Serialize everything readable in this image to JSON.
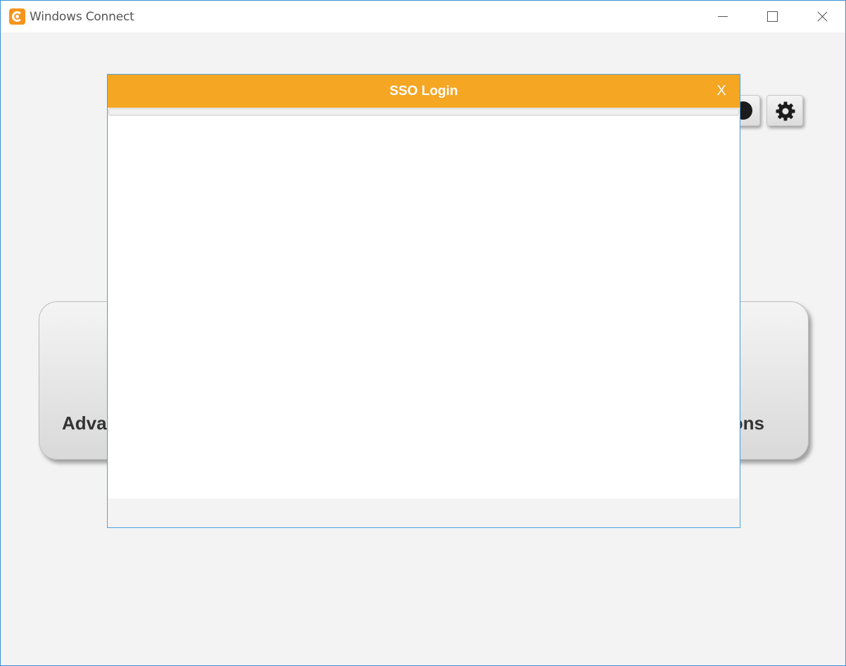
{
  "window": {
    "title": "Windows Connect"
  },
  "main": {
    "tiles": [
      {
        "label": "Adva"
      },
      {
        "label": "ons"
      }
    ],
    "icons": [
      "help-icon",
      "gear-icon"
    ]
  },
  "dialog": {
    "title": "SSO Login",
    "close_label": "X",
    "header_color": "#f5a623"
  },
  "colors": {
    "accent": "#f5a623",
    "window_border": "#3c8fd6"
  }
}
